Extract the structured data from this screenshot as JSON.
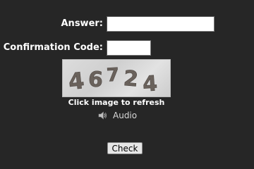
{
  "form": {
    "answer_label": "Answer:",
    "answer_value": "",
    "code_label": "Confirmation Code:",
    "code_value": ""
  },
  "captcha": {
    "text": "46724",
    "refresh_text": "Click image to refresh",
    "audio_label": "Audio",
    "audio_icon": "speaker-icon"
  },
  "actions": {
    "check_label": "Check"
  },
  "colors": {
    "background": "#262626",
    "label": "#ffffff",
    "captcha_glyph": "#6a625c"
  }
}
